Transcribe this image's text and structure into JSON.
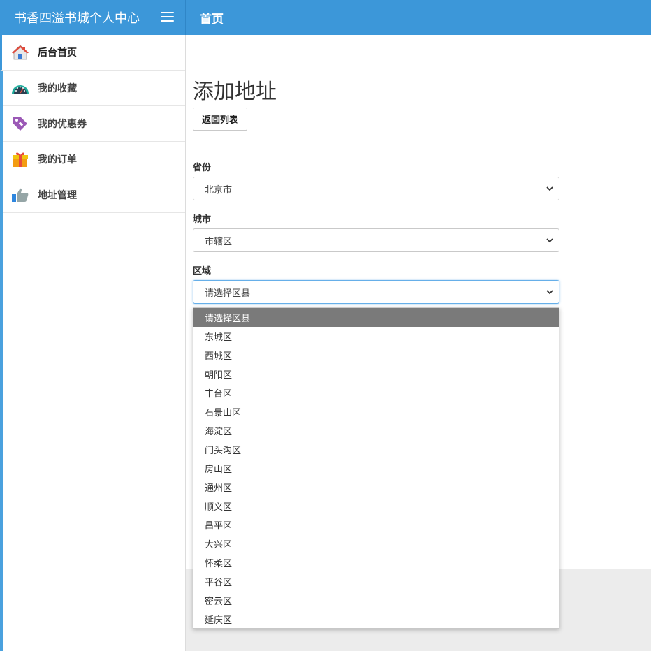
{
  "header": {
    "brand": "书香四溢书城个人中心",
    "page_title": "首页"
  },
  "sidebar": {
    "items": [
      {
        "label": "后台首页",
        "icon": "home-icon"
      },
      {
        "label": "我的收藏",
        "icon": "dashboard-gauge-icon"
      },
      {
        "label": "我的优惠券",
        "icon": "price-tag-icon"
      },
      {
        "label": "我的订单",
        "icon": "gift-box-icon"
      },
      {
        "label": "地址管理",
        "icon": "thumbs-up-icon"
      }
    ]
  },
  "form": {
    "title": "添加地址",
    "back_label": "返回列表",
    "province_label": "省份",
    "province_value": "北京市",
    "city_label": "城市",
    "city_value": "市辖区",
    "district_label": "区域",
    "district_value": "请选择区县"
  },
  "dropdown": {
    "options": [
      "请选择区县",
      "东城区",
      "西城区",
      "朝阳区",
      "丰台区",
      "石景山区",
      "海淀区",
      "门头沟区",
      "房山区",
      "通州区",
      "顺义区",
      "昌平区",
      "大兴区",
      "怀柔区",
      "平谷区",
      "密云区",
      "延庆区"
    ]
  },
  "colors": {
    "header_bg": "#3c97d9",
    "selected_option_bg": "#7a7a7a"
  }
}
